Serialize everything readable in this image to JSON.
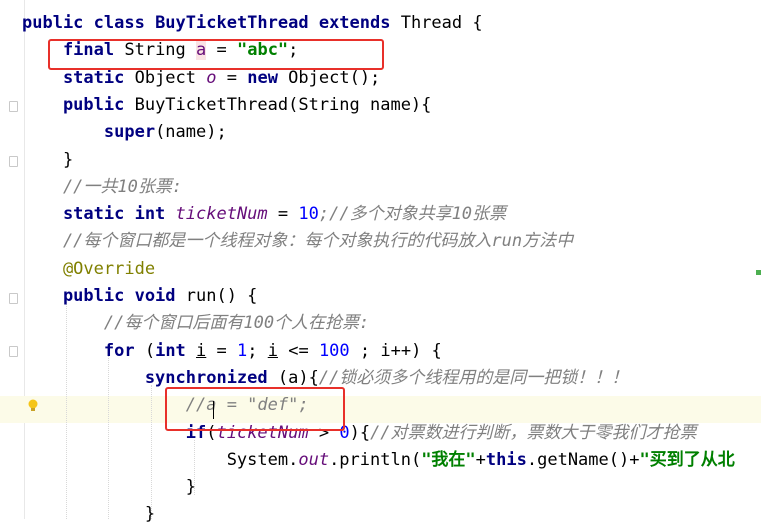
{
  "editor": {
    "lines": [
      {
        "segments": [
          {
            "t": "public class ",
            "c": "kw"
          },
          {
            "t": "BuyTicketThread ",
            "c": "kw"
          },
          {
            "t": "extends ",
            "c": "kw"
          },
          {
            "t": "Thread {",
            "c": ""
          }
        ]
      },
      {
        "segments": [
          {
            "t": "    final ",
            "c": "kw"
          },
          {
            "t": "String ",
            "c": ""
          },
          {
            "t": "a",
            "c": "fieldbg"
          },
          {
            "t": " = ",
            "c": ""
          },
          {
            "t": "\"abc\"",
            "c": "str"
          },
          {
            "t": ";",
            "c": ""
          }
        ]
      },
      {
        "segments": [
          {
            "t": "    static ",
            "c": "kw"
          },
          {
            "t": "Object ",
            "c": ""
          },
          {
            "t": "o",
            "c": "staticf"
          },
          {
            "t": " = ",
            "c": ""
          },
          {
            "t": "new ",
            "c": "kw"
          },
          {
            "t": "Object();",
            "c": ""
          }
        ]
      },
      {
        "segments": [
          {
            "t": "    public ",
            "c": "kw"
          },
          {
            "t": "BuyTicketThread(String name){",
            "c": ""
          }
        ]
      },
      {
        "segments": [
          {
            "t": "        super",
            "c": "kw"
          },
          {
            "t": "(name);",
            "c": ""
          }
        ]
      },
      {
        "segments": [
          {
            "t": "    }",
            "c": ""
          }
        ]
      },
      {
        "segments": [
          {
            "t": "    //一共10张票:",
            "c": "cmt"
          }
        ]
      },
      {
        "segments": [
          {
            "t": "    static int ",
            "c": "kw"
          },
          {
            "t": "ticketNum",
            "c": "staticf"
          },
          {
            "t": " = ",
            "c": ""
          },
          {
            "t": "10",
            "c": "num"
          },
          {
            "t": ";//多个对象共享10张票",
            "c": "cmt"
          }
        ]
      },
      {
        "segments": [
          {
            "t": "    //每个窗口都是一个线程对象：每个对象执行的代码放入run方法中",
            "c": "cmt"
          }
        ]
      },
      {
        "segments": [
          {
            "t": "    @Override",
            "c": "ann"
          }
        ]
      },
      {
        "segments": [
          {
            "t": "    public void ",
            "c": "kw"
          },
          {
            "t": "run() {",
            "c": ""
          }
        ]
      },
      {
        "segments": [
          {
            "t": "        //每个窗口后面有100个人在抢票:",
            "c": "cmt"
          }
        ]
      },
      {
        "segments": [
          {
            "t": "        for ",
            "c": "kw"
          },
          {
            "t": "(",
            "c": ""
          },
          {
            "t": "int ",
            "c": "kw"
          },
          {
            "t": "i",
            "c": "under"
          },
          {
            "t": " = ",
            "c": ""
          },
          {
            "t": "1",
            "c": "num"
          },
          {
            "t": "; ",
            "c": ""
          },
          {
            "t": "i",
            "c": "under"
          },
          {
            "t": " <= ",
            "c": ""
          },
          {
            "t": "100",
            "c": "num"
          },
          {
            "t": " ; i++) {",
            "c": ""
          }
        ]
      },
      {
        "segments": [
          {
            "t": "            synchronized ",
            "c": "kw"
          },
          {
            "t": "(a){",
            "c": ""
          },
          {
            "t": "//锁必须多个线程用的是同一把锁！！！",
            "c": "cmt"
          }
        ]
      },
      {
        "segments": [
          {
            "t": "                //a = \"def\";",
            "c": "cmt"
          }
        ]
      },
      {
        "segments": [
          {
            "t": "                if",
            "c": "kw"
          },
          {
            "t": "(",
            "c": ""
          },
          {
            "t": "ticketNum",
            "c": "staticf"
          },
          {
            "t": " > ",
            "c": ""
          },
          {
            "t": "0",
            "c": "num"
          },
          {
            "t": "){",
            "c": ""
          },
          {
            "t": "//对票数进行判断，票数大于零我们才抢票",
            "c": "cmt"
          }
        ]
      },
      {
        "segments": [
          {
            "t": "                    System.",
            "c": ""
          },
          {
            "t": "out",
            "c": "staticf"
          },
          {
            "t": ".println(",
            "c": ""
          },
          {
            "t": "\"我在\"",
            "c": "str"
          },
          {
            "t": "+",
            "c": ""
          },
          {
            "t": "this",
            "c": "kw"
          },
          {
            "t": ".getName()+",
            "c": ""
          },
          {
            "t": "\"买到了从北",
            "c": "str"
          }
        ]
      },
      {
        "segments": [
          {
            "t": "                }",
            "c": ""
          }
        ]
      },
      {
        "segments": [
          {
            "t": "            }",
            "c": ""
          }
        ]
      }
    ],
    "highlighted_line_index": 14
  }
}
